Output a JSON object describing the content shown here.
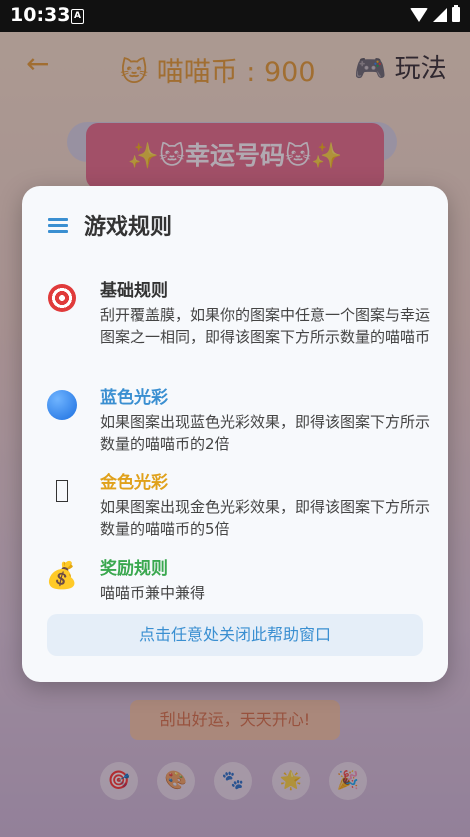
{
  "status_bar": {
    "time": "10:33",
    "notification_glyph": "A"
  },
  "header": {
    "back_icon": "←",
    "coin_label": "🐱 喵喵币 : 900",
    "play_label": "🎮 玩法"
  },
  "lucky_button": {
    "label": "✨🐱幸运号码🐱✨"
  },
  "slogan": "刮出好运，天天开心!",
  "bottom_icons": [
    "🎯",
    "🎨",
    "🐾",
    "🌟",
    "🎉"
  ],
  "dialog": {
    "title": "游戏规则",
    "rules": [
      {
        "icon": "target-icon",
        "title": "基础规则",
        "title_color": "#333333",
        "description": "刮开覆盖膜，如果你的图案中任意一个图案与幸运图案之一相同，即得该图案下方所示数量的喵喵币"
      },
      {
        "icon": "blue-circle-icon",
        "title": "蓝色光彩",
        "title_color": "#3a8fd1",
        "description": "如果图案出现蓝色光彩效果，即得该图案下方所示数量的喵喵币的2倍"
      },
      {
        "icon": "unsupported-glyph-icon",
        "title": "金色光彩",
        "title_color": "#e0a11b",
        "description": "如果图案出现金色光彩效果，即得该图案下方所示数量的喵喵币的5倍"
      },
      {
        "icon": "money-bag-icon",
        "icon_glyph": "💰",
        "title": "奖励规则",
        "title_color": "#3aa84f",
        "description": "喵喵币兼中兼得"
      }
    ],
    "close_hint": "点击任意处关闭此帮助窗口"
  }
}
